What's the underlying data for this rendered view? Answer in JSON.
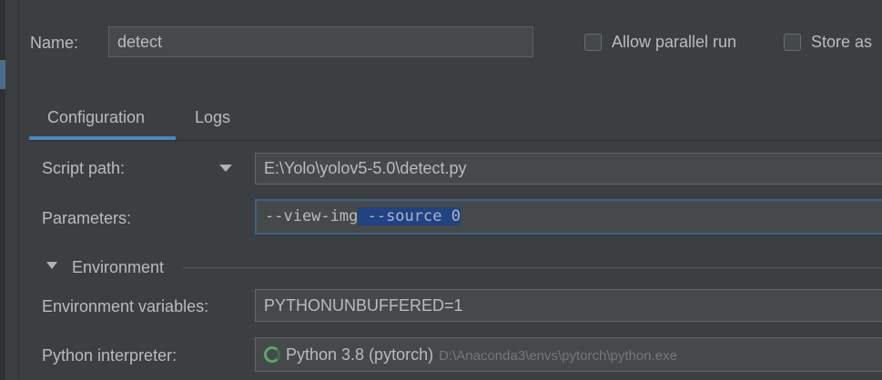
{
  "header": {
    "name_label": "Name:",
    "name_value": "detect",
    "allow_parallel_label": "Allow parallel run",
    "store_as_label": "Store as"
  },
  "tabs": [
    {
      "label": "Configuration",
      "active": true
    },
    {
      "label": "Logs",
      "active": false
    }
  ],
  "form": {
    "script_path_label": "Script path:",
    "script_path_value": "E:\\Yolo\\yolov5-5.0\\detect.py",
    "parameters_label": "Parameters:",
    "parameters_value_plain": "--view-img",
    "parameters_value_selected": " --source 0",
    "environment_section": "Environment",
    "env_vars_label": "Environment variables:",
    "env_vars_value": "PYTHONUNBUFFERED=1",
    "interpreter_label": "Python interpreter:",
    "interpreter_name": "Python 3.8 (pytorch)",
    "interpreter_path": "D:\\Anaconda3\\envs\\pytorch\\python.exe"
  },
  "icons": [
    "chevron-down-icon",
    "collapse-triangle-icon",
    "python-interpreter-spinner-icon",
    "checkbox-icon"
  ],
  "colors": {
    "background": "#3c3f41",
    "accent": "#4a88c7",
    "selection": "#214283",
    "text": "#bbbbbb"
  }
}
